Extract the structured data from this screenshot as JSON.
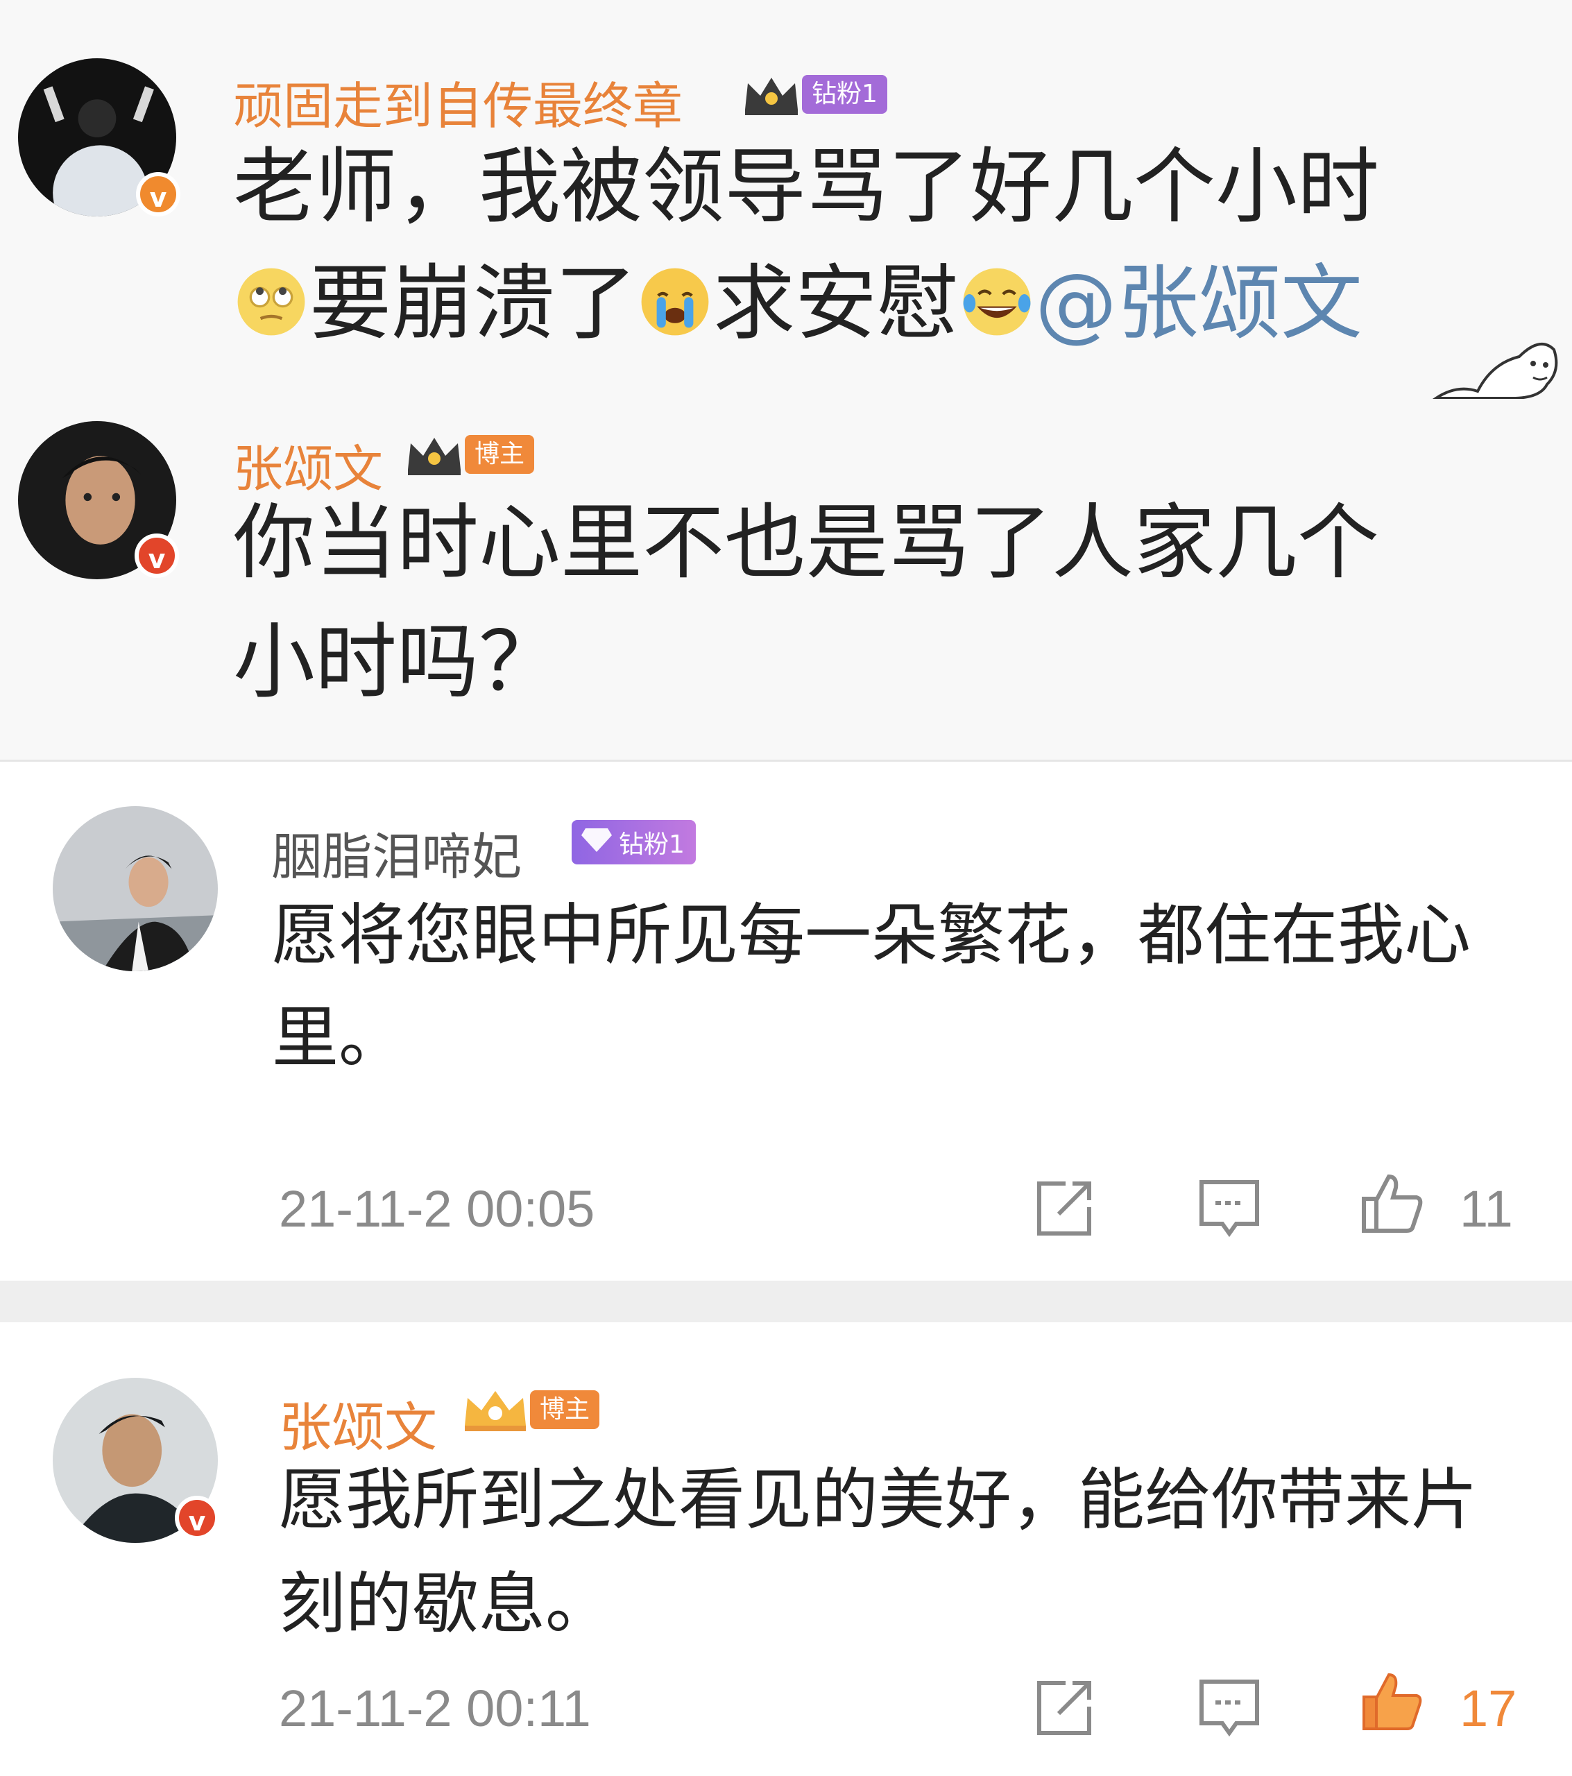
{
  "quoted_thread": [
    {
      "username": "顽固走到自传最终章",
      "badge_label": "钻粉1",
      "text_lines": [
        "老师，我被领导骂了好几个小时",
        "要崩溃了",
        "求安慰",
        "@张颂文"
      ],
      "emojis": [
        "eye-roll-emoji",
        "crying-emoji",
        "laughing-tears-emoji"
      ]
    },
    {
      "username": "张颂文",
      "badge_label": "博主",
      "text_lines": [
        "你当时心里不也是骂了人家几个",
        "小时吗？"
      ]
    }
  ],
  "comments": [
    {
      "username": "胭脂泪啼妃",
      "badge_label": "钻粉1",
      "text_lines": [
        "愿将您眼中所见每一朵繁花，都住在我心",
        "里。"
      ],
      "timestamp": "21-11-2 00:05",
      "like_count": "11",
      "liked": false
    },
    {
      "username": "张颂文",
      "badge_label": "博主",
      "text_lines": [
        "愿我所到之处看见的美好，能给你带来片",
        "刻的歇息。"
      ],
      "timestamp": "21-11-2 00:11",
      "like_count": "17",
      "liked": true
    }
  ],
  "colors": {
    "username_orange": "#e8833a",
    "mention_blue": "#5d86b0",
    "like_active": "#f0893a",
    "meta_grey": "#8a8a8a"
  }
}
